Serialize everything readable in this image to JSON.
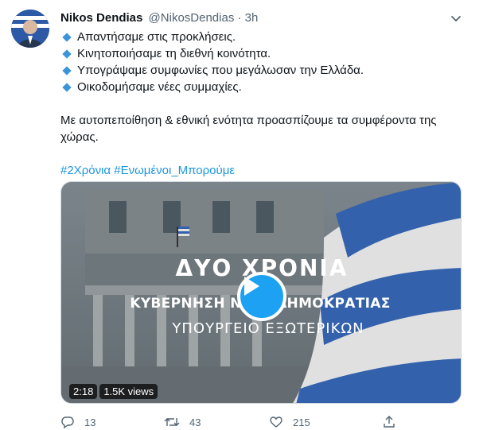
{
  "author": {
    "name": "Nikos Dendias",
    "handle": "@NikosDendias",
    "separator": "·",
    "time": "3h"
  },
  "tweet": {
    "lines": [
      "Απαντήσαμε στις προκλήσεις.",
      "Κινητοποιήσαμε τη διεθνή κοινότητα.",
      "Υπογράψαμε  συμφωνίες που μεγάλωσαν την Ελλάδα.",
      "Οικοδομήσαμε νέες συμμαχίες."
    ],
    "paragraph": "Με αυτοπεποίθηση & εθνική ενότητα προασπίζουμε τα συμφέροντα της χώρας.",
    "hashtags": [
      "#2Χρόνια",
      "#Ενωμένοι_Μπορούμε"
    ]
  },
  "media": {
    "title_line1": "ΔΥΟ ΧΡΟΝΙΑ",
    "title_line2": "ΚΥΒΕΡΝΗΣΗ ΝΕΑΣ ΔΗΜΟΚΡΑΤΙΑΣ",
    "title_line3": "ΥΠΟΥΡΓΕΙΟ ΕΞΩΤΕΡΙΚΩΝ",
    "duration": "2:18",
    "views": "1.5K views"
  },
  "actions": {
    "replies": "13",
    "retweets": "43",
    "likes": "215"
  },
  "colors": {
    "link": "#1b95e0",
    "bullet": "#3b94d9",
    "play": "#1da1f2",
    "flag_blue": "#3b6fc4"
  }
}
